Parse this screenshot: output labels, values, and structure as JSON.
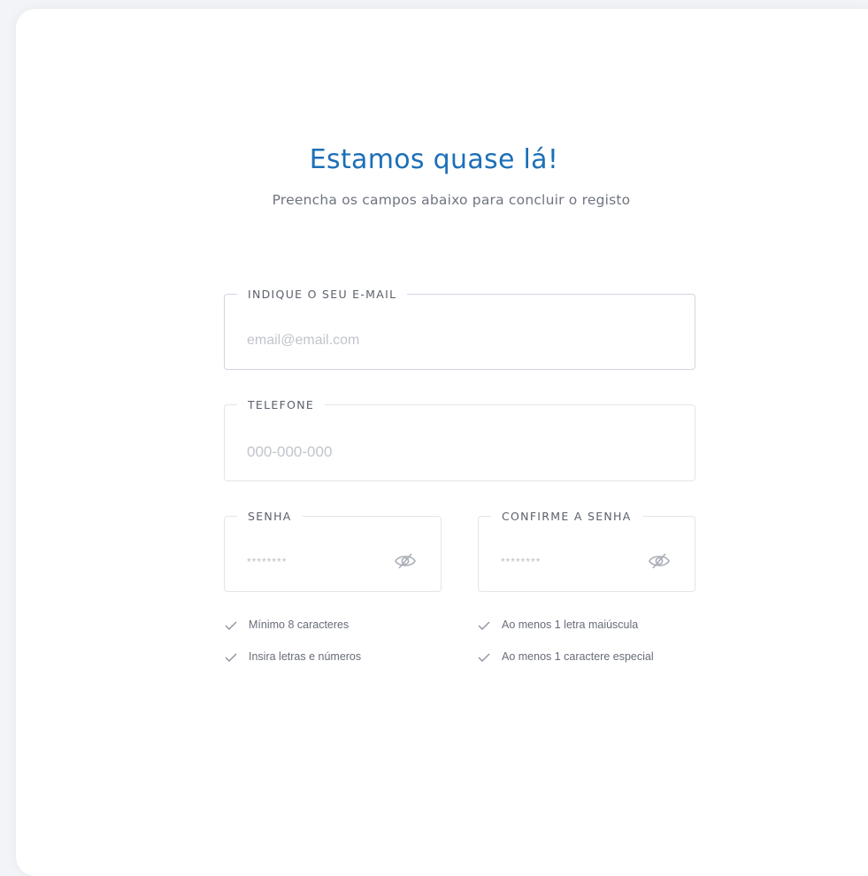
{
  "header": {
    "title": "Estamos quase lá!",
    "subtitle": "Preencha os campos abaixo para concluir o registo"
  },
  "form": {
    "email": {
      "label": "INDIQUE O SEU E-MAIL",
      "placeholder": "email@email.com",
      "value": ""
    },
    "phone": {
      "label": "TELEFONE",
      "placeholder": "000-000-000",
      "value": ""
    },
    "password": {
      "label": "SENHA",
      "placeholder": "********",
      "toggle_icon": "eye-off-icon"
    },
    "confirm_password": {
      "label": "CONFIRME A SENHA",
      "placeholder": "********",
      "toggle_icon": "eye-off-icon"
    }
  },
  "requirements": [
    {
      "text": "Mínimo 8 caracteres",
      "icon": "check-icon"
    },
    {
      "text": "Insira letras e números",
      "icon": "check-icon"
    },
    {
      "text": "Ao menos 1 letra maiúscula",
      "icon": "check-icon"
    },
    {
      "text": "Ao menos 1 caractere especial",
      "icon": "check-icon"
    }
  ],
  "colors": {
    "title": "#1c6fb8",
    "subtitle": "#6f7480",
    "border": "#e3e5eb",
    "background": "#f3f4f7",
    "card": "#ffffff"
  }
}
